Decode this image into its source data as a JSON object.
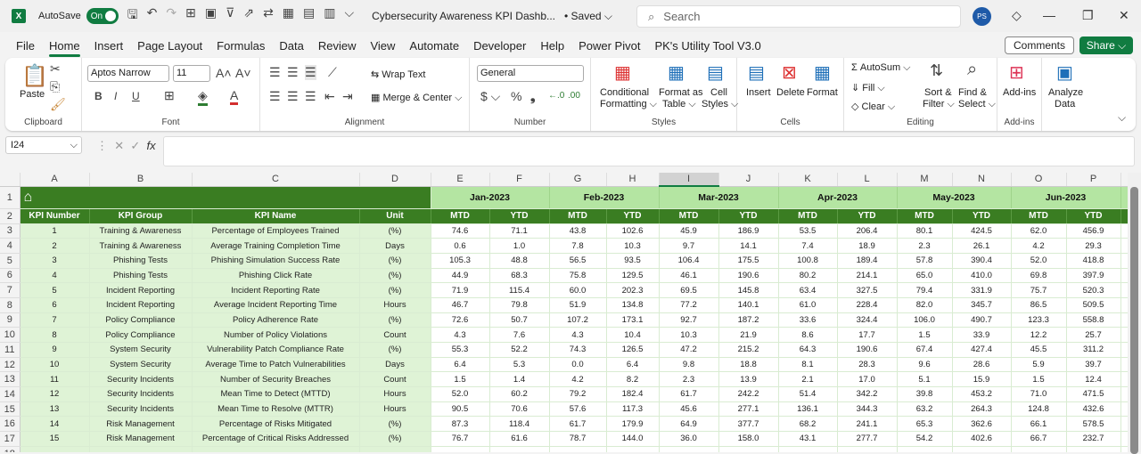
{
  "titlebar": {
    "autosave_label": "AutoSave",
    "autosave_state": "On",
    "doc_title": "Cybersecurity Awareness KPI Dashb...",
    "saved": "• Saved ⌵",
    "search_placeholder": "Search",
    "avatar": "PS"
  },
  "tabs": [
    "File",
    "Home",
    "Insert",
    "Page Layout",
    "Formulas",
    "Data",
    "Review",
    "View",
    "Automate",
    "Developer",
    "Help",
    "Power Pivot",
    "PK's Utility Tool V3.0"
  ],
  "active_tab": "Home",
  "comments_label": "Comments",
  "share_label": "Share",
  "ribbon": {
    "clipboard": {
      "paste": "Paste",
      "label": "Clipboard"
    },
    "font": {
      "name": "Aptos Narrow",
      "size": "11",
      "label": "Font"
    },
    "alignment": {
      "wrap": "Wrap Text",
      "merge": "Merge & Center",
      "label": "Alignment"
    },
    "number": {
      "format": "General",
      "label": "Number"
    },
    "styles": {
      "cond1": "Conditional",
      "cond2": "Formatting ⌵",
      "fat1": "Format as",
      "fat2": "Table ⌵",
      "cs1": "Cell",
      "cs2": "Styles ⌵",
      "label": "Styles"
    },
    "cells": {
      "insert": "Insert",
      "delete": "Delete",
      "format": "Format",
      "label": "Cells"
    },
    "editing": {
      "autosum": "AutoSum",
      "fill": "Fill",
      "clear": "Clear",
      "sort1": "Sort &",
      "sort2": "Filter ⌵",
      "find1": "Find &",
      "find2": "Select ⌵",
      "label": "Editing"
    },
    "addins": {
      "addins": "Add-ins",
      "label": "Add-ins"
    },
    "analyze": {
      "l1": "Analyze",
      "l2": "Data"
    }
  },
  "formula_bar": {
    "name_box": "I24",
    "fx": "fx",
    "value": ""
  },
  "columns": [
    "A",
    "B",
    "C",
    "D",
    "E",
    "F",
    "G",
    "H",
    "I",
    "J",
    "K",
    "L",
    "M",
    "N",
    "O",
    "P"
  ],
  "selected_column": "I",
  "months": [
    "Jan-2023",
    "Feb-2023",
    "Mar-2023",
    "Apr-2023",
    "May-2023",
    "Jun-2023"
  ],
  "headers": [
    "KPI Number",
    "KPI Group",
    "KPI Name",
    "Unit"
  ],
  "sub_headers": [
    "MTD",
    "YTD"
  ],
  "rows": [
    [
      "1",
      "Training & Awareness",
      "Percentage of Employees Trained",
      "(%)",
      "74.6",
      "71.1",
      "43.8",
      "102.6",
      "45.9",
      "186.9",
      "53.5",
      "206.4",
      "80.1",
      "424.5",
      "62.0",
      "456.9"
    ],
    [
      "2",
      "Training & Awareness",
      "Average Training Completion Time",
      "Days",
      "0.6",
      "1.0",
      "7.8",
      "10.3",
      "9.7",
      "14.1",
      "7.4",
      "18.9",
      "2.3",
      "26.1",
      "4.2",
      "29.3"
    ],
    [
      "3",
      "Phishing Tests",
      "Phishing Simulation Success Rate",
      "(%)",
      "105.3",
      "48.8",
      "56.5",
      "93.5",
      "106.4",
      "175.5",
      "100.8",
      "189.4",
      "57.8",
      "390.4",
      "52.0",
      "418.8"
    ],
    [
      "4",
      "Phishing Tests",
      "Phishing Click Rate",
      "(%)",
      "44.9",
      "68.3",
      "75.8",
      "129.5",
      "46.1",
      "190.6",
      "80.2",
      "214.1",
      "65.0",
      "410.0",
      "69.8",
      "397.9"
    ],
    [
      "5",
      "Incident Reporting",
      "Incident Reporting Rate",
      "(%)",
      "71.9",
      "115.4",
      "60.0",
      "202.3",
      "69.5",
      "145.8",
      "63.4",
      "327.5",
      "79.4",
      "331.9",
      "75.7",
      "520.3"
    ],
    [
      "6",
      "Incident Reporting",
      "Average Incident Reporting Time",
      "Hours",
      "46.7",
      "79.8",
      "51.9",
      "134.8",
      "77.2",
      "140.1",
      "61.0",
      "228.4",
      "82.0",
      "345.7",
      "86.5",
      "509.5"
    ],
    [
      "7",
      "Policy Compliance",
      "Policy Adherence Rate",
      "(%)",
      "72.6",
      "50.7",
      "107.2",
      "173.1",
      "92.7",
      "187.2",
      "33.6",
      "324.4",
      "106.0",
      "490.7",
      "123.3",
      "558.8"
    ],
    [
      "8",
      "Policy Compliance",
      "Number of Policy Violations",
      "Count",
      "4.3",
      "7.6",
      "4.3",
      "10.4",
      "10.3",
      "21.9",
      "8.6",
      "17.7",
      "1.5",
      "33.9",
      "12.2",
      "25.7"
    ],
    [
      "9",
      "System Security",
      "Vulnerability Patch Compliance Rate",
      "(%)",
      "55.3",
      "52.2",
      "74.3",
      "126.5",
      "47.2",
      "215.2",
      "64.3",
      "190.6",
      "67.4",
      "427.4",
      "45.5",
      "311.2"
    ],
    [
      "10",
      "System Security",
      "Average Time to Patch Vulnerabilities",
      "Days",
      "6.4",
      "5.3",
      "0.0",
      "6.4",
      "9.8",
      "18.8",
      "8.1",
      "28.3",
      "9.6",
      "28.6",
      "5.9",
      "39.7"
    ],
    [
      "11",
      "Security Incidents",
      "Number of Security Breaches",
      "Count",
      "1.5",
      "1.4",
      "4.2",
      "8.2",
      "2.3",
      "13.9",
      "2.1",
      "17.0",
      "5.1",
      "15.9",
      "1.5",
      "12.4"
    ],
    [
      "12",
      "Security Incidents",
      "Mean Time to Detect (MTTD)",
      "Hours",
      "52.0",
      "60.2",
      "79.2",
      "182.4",
      "61.7",
      "242.2",
      "51.4",
      "342.2",
      "39.8",
      "453.2",
      "71.0",
      "471.5"
    ],
    [
      "13",
      "Security Incidents",
      "Mean Time to Resolve (MTTR)",
      "Hours",
      "90.5",
      "70.6",
      "57.6",
      "117.3",
      "45.6",
      "277.1",
      "136.1",
      "344.3",
      "63.2",
      "264.3",
      "124.8",
      "432.6"
    ],
    [
      "14",
      "Risk Management",
      "Percentage of Risks Mitigated",
      "(%)",
      "87.3",
      "118.4",
      "61.7",
      "179.9",
      "64.9",
      "377.7",
      "68.2",
      "241.1",
      "65.3",
      "362.6",
      "66.1",
      "578.5"
    ],
    [
      "15",
      "Risk Management",
      "Percentage of Critical Risks Addressed",
      "(%)",
      "76.7",
      "61.6",
      "78.7",
      "144.0",
      "36.0",
      "158.0",
      "43.1",
      "277.7",
      "54.2",
      "402.6",
      "66.7",
      "232.7"
    ]
  ],
  "colors": {
    "accent": "#107c41",
    "header_dark_green": "#3a7d22",
    "month_light_green": "#b4e5a2",
    "label_cell_green": "#dff3d6"
  }
}
